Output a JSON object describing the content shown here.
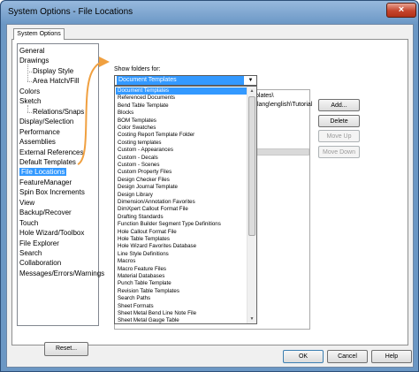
{
  "window": {
    "title": "System Options - File Locations",
    "close_glyph": "×"
  },
  "tab": {
    "label": "System Options"
  },
  "tree": {
    "items": [
      {
        "label": "General",
        "level": 0
      },
      {
        "label": "Drawings",
        "level": 0
      },
      {
        "label": "Display Style",
        "level": 1
      },
      {
        "label": "Area Hatch/Fill",
        "level": 1
      },
      {
        "label": "Colors",
        "level": 0
      },
      {
        "label": "Sketch",
        "level": 0
      },
      {
        "label": "Relations/Snaps",
        "level": 1
      },
      {
        "label": "Display/Selection",
        "level": 0
      },
      {
        "label": "Performance",
        "level": 0
      },
      {
        "label": "Assemblies",
        "level": 0
      },
      {
        "label": "External References",
        "level": 0
      },
      {
        "label": "Default Templates",
        "level": 0
      },
      {
        "label": "File Locations",
        "level": 0,
        "selected": true
      },
      {
        "label": "FeatureManager",
        "level": 0
      },
      {
        "label": "Spin Box Increments",
        "level": 0
      },
      {
        "label": "View",
        "level": 0
      },
      {
        "label": "Backup/Recover",
        "level": 0
      },
      {
        "label": "Touch",
        "level": 0
      },
      {
        "label": "Hole Wizard/Toolbox",
        "level": 0
      },
      {
        "label": "File Explorer",
        "level": 0
      },
      {
        "label": "Search",
        "level": 0
      },
      {
        "label": "Collaboration",
        "level": 0
      },
      {
        "label": "Messages/Errors/Warnings",
        "level": 0
      }
    ]
  },
  "reset_label": "Reset...",
  "show_folders_label": "Show folders for:",
  "combo_value": "Document Templates",
  "combo_arrow": "▼",
  "folder_paths": [
    "plates\\",
    "\\lang\\english\\Tutorial"
  ],
  "dropdown": {
    "selected": "Document Templates",
    "items": [
      "Document Templates",
      "Referenced Documents",
      "Bend Table Template",
      "Blocks",
      "BOM Templates",
      "Color Swatches",
      "Costing Report Template Folder",
      "Costing templates",
      "Custom - Appearances",
      "Custom - Decals",
      "Custom - Scenes",
      "Custom Property Files",
      "Design Checker Files",
      "Design Journal Template",
      "Design Library",
      "Dimension/Annotation Favorites",
      "DimXpert Callout Format File",
      "Drafting Standards",
      "Function Builder Segment Type Definitions",
      "Hole Callout Format File",
      "Hole Table Templates",
      "Hole Wizard Favorites Database",
      "Line Style Definitions",
      "Macros",
      "Macro Feature Files",
      "Material Databases",
      "Punch Table Template",
      "Revision Table Templates",
      "Search Paths",
      "Sheet Formats",
      "Sheet Metal Bend Line Note File",
      "Sheet Metal Gauge Table"
    ],
    "scroll_up": "▲",
    "scroll_down": "▼"
  },
  "buttons": {
    "add": "Add...",
    "delete": "Delete",
    "move_up": "Move Up",
    "move_down": "Move Down",
    "ok": "OK",
    "cancel": "Cancel",
    "help": "Help"
  },
  "colors": {
    "selection": "#3399ff",
    "callout_arrow": "#f0a040",
    "title_bar": "#7aa4cf"
  }
}
